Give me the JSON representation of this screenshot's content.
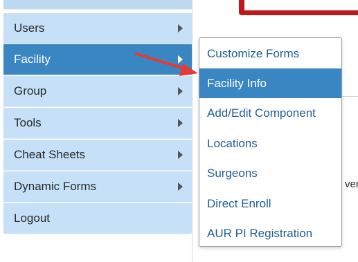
{
  "sidebar": {
    "items": [
      {
        "label": "Users",
        "has_submenu": true,
        "active": false
      },
      {
        "label": "Facility",
        "has_submenu": true,
        "active": true
      },
      {
        "label": "Group",
        "has_submenu": true,
        "active": false
      },
      {
        "label": "Tools",
        "has_submenu": true,
        "active": false
      },
      {
        "label": "Cheat Sheets",
        "has_submenu": true,
        "active": false
      },
      {
        "label": "Dynamic Forms",
        "has_submenu": true,
        "active": false
      },
      {
        "label": "Logout",
        "has_submenu": false,
        "active": false
      }
    ]
  },
  "submenu": {
    "items": [
      {
        "label": "Customize Forms",
        "highlighted": false
      },
      {
        "label": "Facility Info",
        "highlighted": true
      },
      {
        "label": "Add/Edit Component",
        "highlighted": false
      },
      {
        "label": "Locations",
        "highlighted": false
      },
      {
        "label": "Surgeons",
        "highlighted": false
      },
      {
        "label": "Direct Enroll",
        "highlighted": false
      },
      {
        "label": "AUR PI Registration",
        "highlighted": false
      }
    ]
  },
  "background": {
    "partial_text": "ven"
  },
  "colors": {
    "sidebar_bg": "#c5e0f7",
    "active_bg": "#3a86c2",
    "submenu_text": "#1f5f94",
    "annotation_arrow": "#e53935",
    "frame_accent": "#c0171b"
  }
}
